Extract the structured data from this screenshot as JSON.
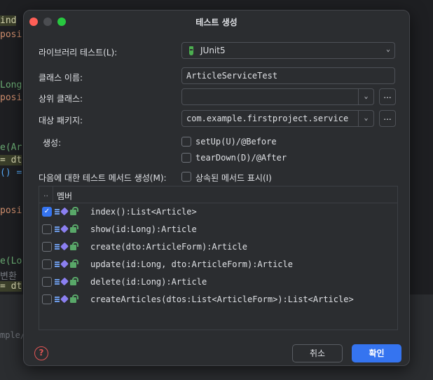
{
  "editor": {
    "fragments": [
      "ind",
      "posi",
      "Long",
      "posi",
      "e(Ar",
      "= dt",
      "() =",
      "posi",
      "e(Lo",
      "변환",
      "= dt"
    ],
    "bottom_path": "mple/f"
  },
  "dialog": {
    "title": "테스트 생성",
    "library_label": "라이브러리 테스트(L):",
    "library_value": "JUnit5",
    "class_name_label": "클래스 이름:",
    "class_name_value": "ArticleServiceTest",
    "superclass_label": "상위 클래스:",
    "superclass_value": "",
    "package_label": "대상 패키지:",
    "package_value": "com.example.firstproject.service",
    "ellipsis": "...",
    "generate_label": "생성:",
    "setup_label": "setUp(U)/@Before",
    "setup_checked": false,
    "teardown_label": "tearDown(D)/@After",
    "teardown_checked": false,
    "methods_label": "다음에 대한 테스트 메서드 생성(M):",
    "inherited_label": "상속된 메서드 표시(I)",
    "inherited_checked": false,
    "table": {
      "dots_header": "..",
      "member_header": "멤버",
      "rows": [
        {
          "checked": true,
          "signature": "index():List<Article>"
        },
        {
          "checked": false,
          "signature": "show(id:Long):Article"
        },
        {
          "checked": false,
          "signature": "create(dto:ArticleForm):Article"
        },
        {
          "checked": false,
          "signature": "update(id:Long, dto:ArticleForm):Article"
        },
        {
          "checked": false,
          "signature": "delete(id:Long):Article"
        },
        {
          "checked": false,
          "signature": "createArticles(dtos:List<ArticleForm>):List<Article>"
        }
      ]
    },
    "help_symbol": "?",
    "cancel_label": "취소",
    "ok_label": "확인",
    "check_mark": "✓",
    "dropdown_arrow": "⌄",
    "icons": {
      "help": "help-icon",
      "junit": "junit-icon",
      "dropdown": "chevron-down-icon",
      "method_lines": "method-lines-icon",
      "method_cube": "method-cube-icon",
      "method_lock": "public-lock-icon"
    }
  }
}
